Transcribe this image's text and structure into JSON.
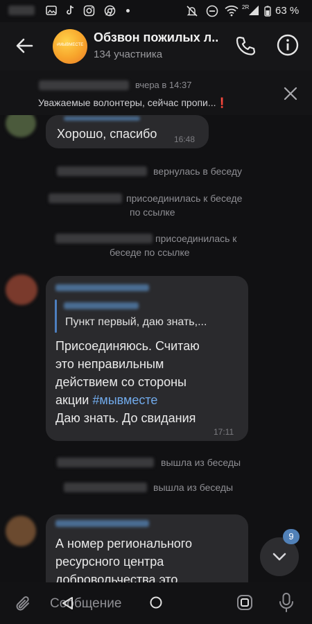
{
  "status_bar": {
    "battery": "63 %",
    "net": "2R"
  },
  "header": {
    "title": "Обзвон пожилых л..",
    "subtitle": "134 участника",
    "avatar_text": "#МЫВМЕСТЕ"
  },
  "pinned": {
    "time": "вчера в 14:37",
    "text": "Уважаемые волонтеры, сейчас пропи...",
    "mark": "❗"
  },
  "messages": {
    "m1": {
      "text": "Хорошо, спасибо",
      "time": "16:48"
    },
    "m2": {
      "reply_text": "Пункт первый, даю знать,...",
      "lines": [
        "Присоединяюсь. Считаю",
        "это неправильным",
        "действием со стороны",
        "акции "
      ],
      "hashtag": "#мывместе",
      "last_line": "Даю знать. До свидания",
      "time": "17:11"
    },
    "m3": {
      "lines": [
        "А номер регионального",
        "ресурсного центра",
        "добровольчества это"
      ]
    }
  },
  "system": {
    "s1": "вернулась в беседу",
    "s2a": "присоединилась к беседе",
    "s2b": "по ссылке",
    "s3a": "присоединилась к",
    "s3b": "беседе по ссылке",
    "s4": "вышла из беседы",
    "s5": "вышла из беседы"
  },
  "scroll_fab": {
    "unread": "9"
  },
  "composer": {
    "placeholder": "Сообщение"
  },
  "colors": {
    "accent": "#71aaeb",
    "bubble": "#2a2a2d",
    "background": "#111113",
    "badge": "#5181b8"
  }
}
